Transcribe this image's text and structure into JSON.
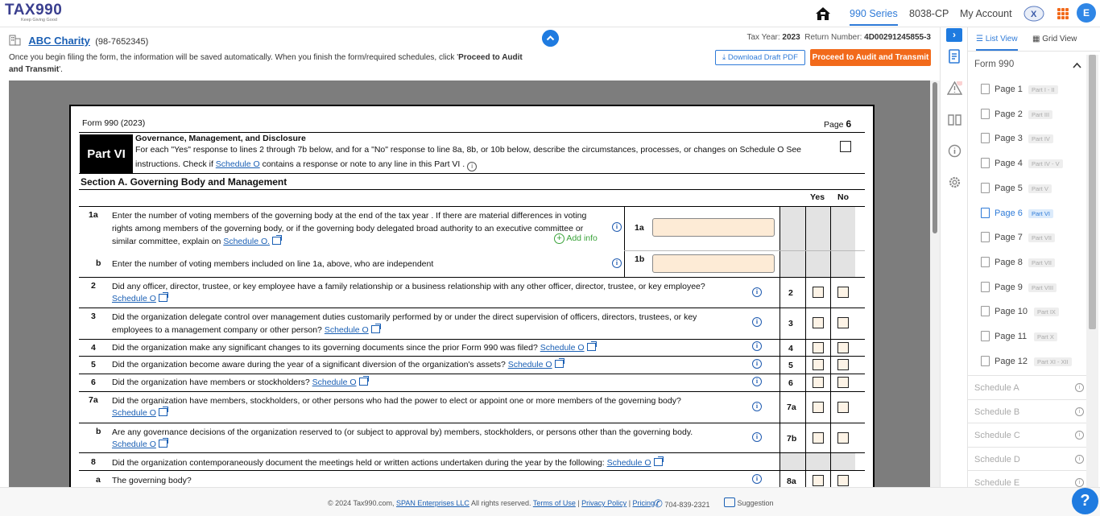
{
  "topbar": {
    "logo_text": "TAX990",
    "logo_tagline": "Keep Giving Good",
    "nav": [
      "990 Series",
      "8038-CP",
      "My Account"
    ],
    "user_initial": "E"
  },
  "header": {
    "org_name": "ABC Charity",
    "ein": "(98-7652345)",
    "info_text_prefix": "Once you begin filing the form, the information will be saved automatically. When you finish the form/required schedules, click '",
    "info_text_bold": "Proceed to Audit and Transmit",
    "info_text_suffix": "'.",
    "tax_year_label": "Tax Year:",
    "tax_year": "2023",
    "return_number_label": "Return Number:",
    "return_number": "4D00291245855-3",
    "download_label": "Download Draft PDF",
    "proceed_label": "Proceed to Audit and Transmit"
  },
  "form": {
    "form_id": "Form 990 (2023)",
    "page_label": "Page",
    "page_num": "6",
    "part": "Part VI",
    "part_title": "Governance, Management, and Disclosure",
    "part_desc_1": "For each \"Yes\" response to lines 2 through 7b below, and for a \"No\" response to line 8a, 8b, or 10b below, describe the circumstances, processes, or changes on Schedule O See",
    "part_desc_2a": "instructions. Check if",
    "part_desc_2b": "Schedule O",
    "part_desc_2c": "contains a response or note to any line in this Part VI .",
    "section_a": "Section A. Governing Body and Management",
    "yes": "Yes",
    "no": "No",
    "add_info": "Add info",
    "schedule_o": "Schedule O",
    "lines": [
      {
        "num": "1a",
        "text1": "Enter the number of voting members of the governing body at the end of the tax year . If there are material differences in voting",
        "text2": "rights among members of the governing body, or if the governing body delegated broad authority to an executive committee or",
        "text3": "similar committee, explain on",
        "link": "Schedule O.",
        "box": "1a"
      },
      {
        "num": "b",
        "text1": "Enter the number of voting members included on line 1a, above, who are independent",
        "box": "1b"
      },
      {
        "num": "2",
        "text1": "Did any officer, director, trustee, or key employee have a family relationship or a business relationship with any other officer, director, trustee, or key employee?",
        "box": "2"
      },
      {
        "num": "3",
        "text1": "Did the organization delegate control over management duties customarily performed by or under the direct supervision of officers, directors, trustees, or key",
        "text2": "employees to a management company or other person?",
        "box": "3"
      },
      {
        "num": "4",
        "text1": "Did the organization make any significant changes to its governing documents since the prior Form 990 was filed?",
        "box": "4"
      },
      {
        "num": "5",
        "text1": "Did the organization become aware during the year of a significant diversion of the organization's assets?",
        "box": "5"
      },
      {
        "num": "6",
        "text1": "Did the organization have members or stockholders?",
        "box": "6"
      },
      {
        "num": "7a",
        "text1": "Did the organization have members, stockholders, or other persons who had the power to elect or appoint one or more members of the governing body?",
        "box": "7a"
      },
      {
        "num": "b",
        "text1": "Are any governance decisions of the organization reserved to (or subject to approval by) members, stockholders, or persons other than the governing body.",
        "box": "7b"
      },
      {
        "num": "8",
        "text1": "Did the organization contemporaneously document the meetings held or written actions undertaken during the year by the following:"
      },
      {
        "num": "a",
        "text1": "The governing body?",
        "box": "8a"
      }
    ]
  },
  "panel": {
    "tabs": [
      "List View",
      "Grid View"
    ],
    "form_title": "Form 990",
    "pages": [
      {
        "label": "Page 1",
        "tag": "Part I - II"
      },
      {
        "label": "Page 2",
        "tag": "Part III"
      },
      {
        "label": "Page 3",
        "tag": "Part IV"
      },
      {
        "label": "Page 4",
        "tag": "Part IV - V"
      },
      {
        "label": "Page 5",
        "tag": "Part V"
      },
      {
        "label": "Page 6",
        "tag": "Part VI"
      },
      {
        "label": "Page 7",
        "tag": "Part VII"
      },
      {
        "label": "Page 8",
        "tag": "Part VII"
      },
      {
        "label": "Page 9",
        "tag": "Part VIII"
      },
      {
        "label": "Page 10",
        "tag": "Part IX"
      },
      {
        "label": "Page 11",
        "tag": "Part X"
      },
      {
        "label": "Page 12",
        "tag": "Part XI - XII"
      }
    ],
    "schedules": [
      "Schedule A",
      "Schedule B",
      "Schedule C",
      "Schedule D",
      "Schedule E"
    ]
  },
  "footer": {
    "copyright": "© 2024 Tax990.com,",
    "company": "SPAN Enterprises LLC",
    "rights": "All rights reserved.",
    "terms": "Terms of Use",
    "privacy": "Privacy Policy",
    "pricing": "Pricing",
    "phone": "704-839-2321",
    "suggestion": "Suggestion"
  },
  "colors": {
    "accent": "#2f7bd8",
    "orange": "#f26a1b",
    "input_bg": "#fdebd6"
  }
}
